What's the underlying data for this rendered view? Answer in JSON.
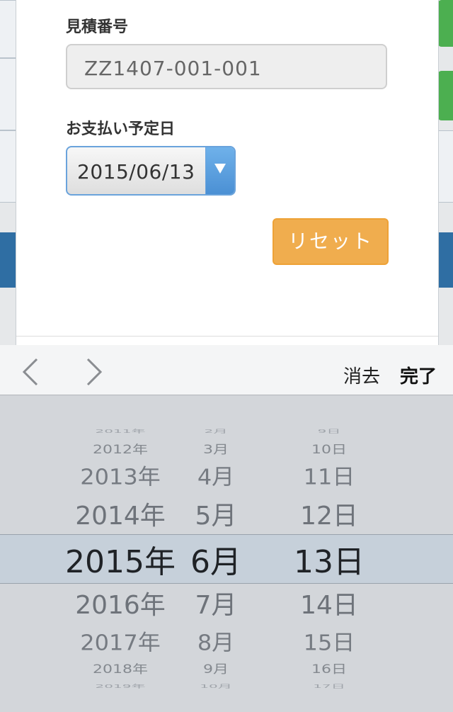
{
  "form": {
    "estimate_label": "見積番号",
    "estimate_value": "ZZ1407-001-001",
    "payment_label": "お支払い予定日",
    "payment_value": "2015/06/13",
    "reset_label": "リセット"
  },
  "toolbar": {
    "clear_label": "消去",
    "done_label": "完了"
  },
  "picker": {
    "years": [
      "2011年",
      "2012年",
      "2013年",
      "2014年",
      "2015年",
      "2016年",
      "2017年",
      "2018年",
      "2019年"
    ],
    "months": [
      "2月",
      "3月",
      "4月",
      "5月",
      "6月",
      "7月",
      "8月",
      "9月",
      "10月"
    ],
    "days": [
      "9日",
      "10日",
      "11日",
      "12日",
      "13日",
      "14日",
      "15日",
      "16日",
      "17日"
    ],
    "selected_index": 4
  },
  "colors": {
    "reset_button": "#f0ad4e",
    "select_accent": "#4b90d4",
    "selection_band": "#c6d0da"
  }
}
